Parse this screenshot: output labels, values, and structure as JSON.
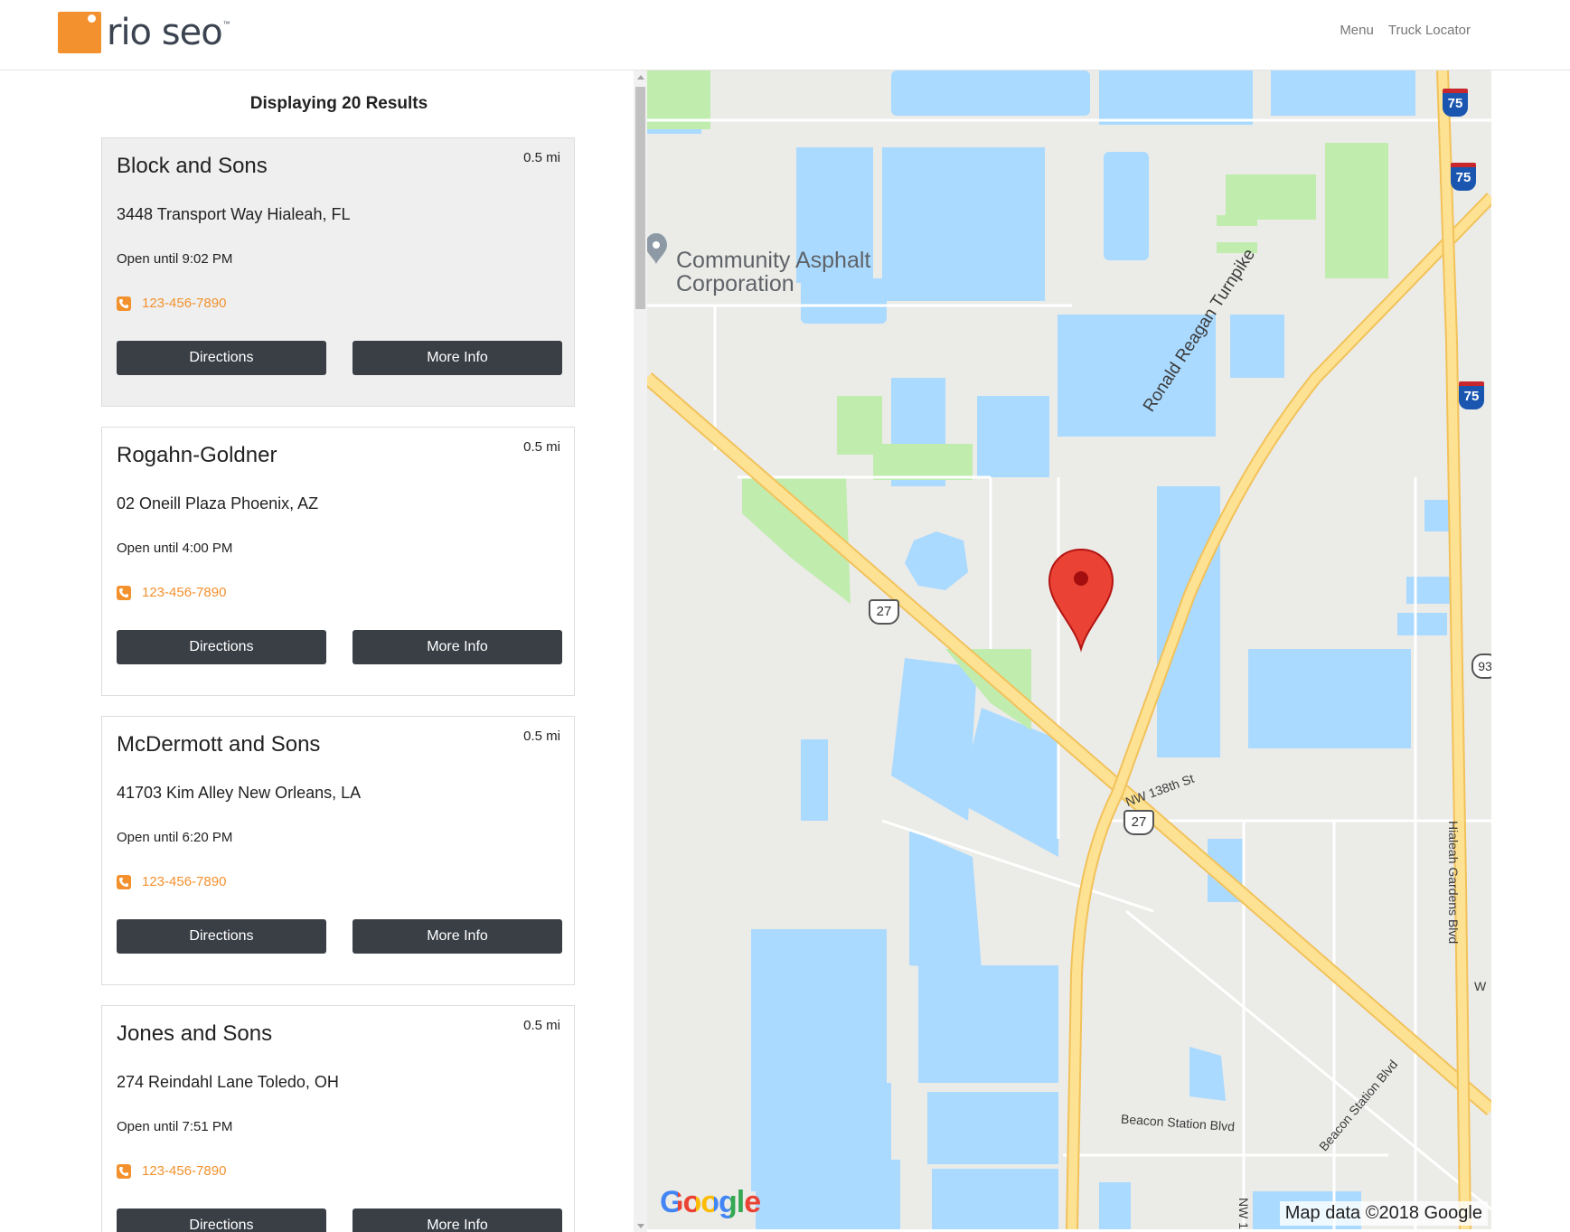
{
  "header": {
    "logo_text": "rio seo",
    "logo_tm": "™",
    "nav": [
      {
        "label": "Menu"
      },
      {
        "label": "Truck Locator"
      }
    ]
  },
  "results": {
    "heading": "Displaying 20 Results",
    "items": [
      {
        "name": "Block and Sons",
        "distance": "0.5 mi",
        "address": "3448 Transport Way Hialeah, FL",
        "hours": "Open until 9:02 PM",
        "phone": "123-456-7890",
        "directions_label": "Directions",
        "more_label": "More Info"
      },
      {
        "name": "Rogahn-Goldner",
        "distance": "0.5 mi",
        "address": "02 Oneill Plaza Phoenix, AZ",
        "hours": "Open until 4:00 PM",
        "phone": "123-456-7890",
        "directions_label": "Directions",
        "more_label": "More Info"
      },
      {
        "name": "McDermott and Sons",
        "distance": "0.5 mi",
        "address": "41703 Kim Alley New Orleans, LA",
        "hours": "Open until 6:20 PM",
        "phone": "123-456-7890",
        "directions_label": "Directions",
        "more_label": "More Info"
      },
      {
        "name": "Jones and Sons",
        "distance": "0.5 mi",
        "address": "274 Reindahl Lane Toledo, OH",
        "hours": "Open until 7:51 PM",
        "phone": "123-456-7890",
        "directions_label": "Directions",
        "more_label": "More Info"
      }
    ]
  },
  "map": {
    "place_line1": "Community Asphalt",
    "place_line2": "Corporation",
    "turnpike_label": "Ronald Reagan Turnpike",
    "road_nw138": "NW 138th St",
    "road_beacon": "Beacon Station Blvd",
    "road_beacon2": "Beacon Station Blvd",
    "road_hialeah": "Hialeah Gardens Blvd",
    "shield_us27": "27",
    "shield_i75": "75",
    "shield_93": "93",
    "road_w": "W",
    "road_nw1": "NW 1",
    "google_logo": "Google",
    "attribution": "Map data ©2018 Google"
  },
  "colors": {
    "accent": "#f3912e",
    "button_bg": "#3a3f46",
    "map_land": "#ebebe8",
    "map_water": "#aadaff",
    "map_park": "#c0ecae",
    "map_highway": "#fde293",
    "marker_red": "#ea4335"
  }
}
